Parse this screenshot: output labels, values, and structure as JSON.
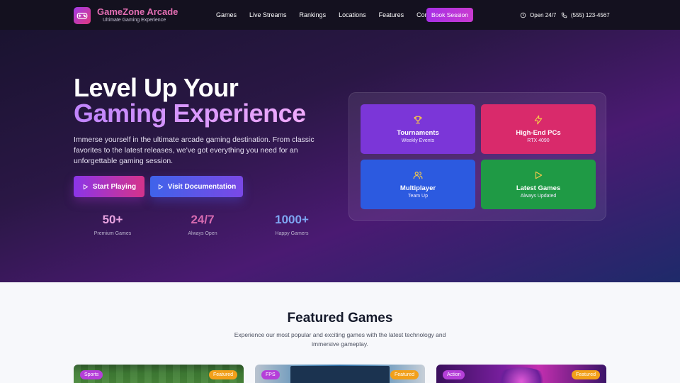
{
  "brand": {
    "name": "GameZone Arcade",
    "tagline": "Ultimate Gaming Experience"
  },
  "nav": {
    "items": [
      "Games",
      "Live Streams",
      "Rankings",
      "Locations",
      "Features",
      "Contact"
    ],
    "cta_label": "Book Session",
    "hours": "Open 24/7",
    "phone": "(555) 123-4567"
  },
  "hero": {
    "title_line1": "Level Up Your",
    "title_line2": "Gaming Experience",
    "description": "Immerse yourself in the ultimate arcade gaming destination. From classic favorites to the latest releases, we've got everything you need for an unforgettable gaming session.",
    "primary_button": "Start Playing",
    "secondary_button": "Visit Documentation",
    "stats": [
      {
        "value": "50+",
        "label": "Premium Games",
        "color": "#e8a3e0"
      },
      {
        "value": "24/7",
        "label": "Always Open",
        "color": "#d66ab0"
      },
      {
        "value": "1000+",
        "label": "Happy Gamers",
        "color": "#7ea6f2"
      }
    ]
  },
  "features": [
    {
      "title": "Tournaments",
      "subtitle": "Weekly Events",
      "icon": "trophy-icon",
      "color": "#7b36d8",
      "icon_color": "#f6c84a"
    },
    {
      "title": "High-End PCs",
      "subtitle": "RTX 4090",
      "icon": "lightning-icon",
      "color": "#d92a6b",
      "icon_color": "#f6c84a"
    },
    {
      "title": "Multiplayer",
      "subtitle": "Team Up",
      "icon": "users-icon",
      "color": "#2c5ae0",
      "icon_color": "#f6c84a"
    },
    {
      "title": "Latest Games",
      "subtitle": "Always Updated",
      "icon": "play-icon",
      "color": "#1f9a45",
      "icon_color": "#f6c84a"
    }
  ],
  "featured": {
    "title": "Featured Games",
    "description": "Experience our most popular and exciting games with the latest technology and immersive gameplay.",
    "cards": [
      {
        "category": "Sports",
        "badge": "Featured"
      },
      {
        "category": "FPS",
        "badge": "Featured"
      },
      {
        "category": "Action",
        "badge": "Featured"
      }
    ]
  }
}
